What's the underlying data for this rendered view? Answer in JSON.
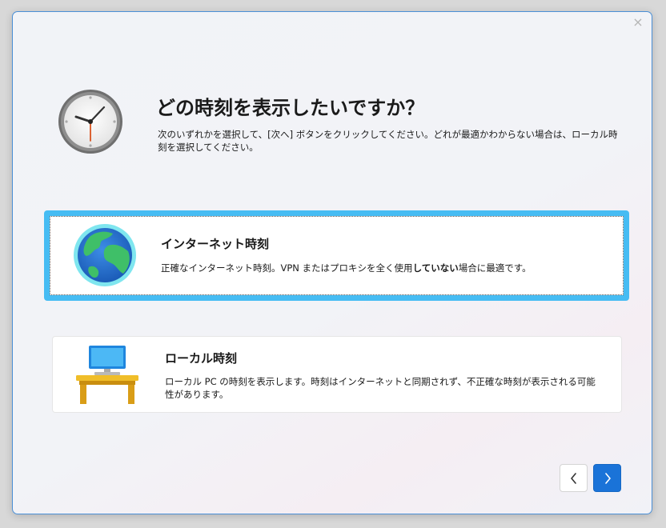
{
  "window": {
    "close_label": "×"
  },
  "header": {
    "title": "どの時刻を表示したいですか？",
    "description": "次のいずれかを選択して、[次へ] ボタンをクリックしてください。どれが最適かわからない場合は、ローカル時刻を選択してください。"
  },
  "options": [
    {
      "title": "インターネット時刻",
      "desc_before": "正確なインターネット時刻。VPN またはプロキシを全く使用",
      "desc_bold": "していない",
      "desc_after": "場合に最適です。",
      "selected": true,
      "icon": "globe-icon"
    },
    {
      "title": "ローカル時刻",
      "description": "ローカル PC の時刻を表示します。時刻はインターネットと同期されず、不正確な時刻が表示される可能性があります。",
      "selected": false,
      "icon": "desk-computer-icon"
    }
  ],
  "navigation": {
    "back_symbol": "‹",
    "next_symbol": "›"
  },
  "colors": {
    "accent": "#1a73d8",
    "selection_border": "#46bcf3"
  }
}
